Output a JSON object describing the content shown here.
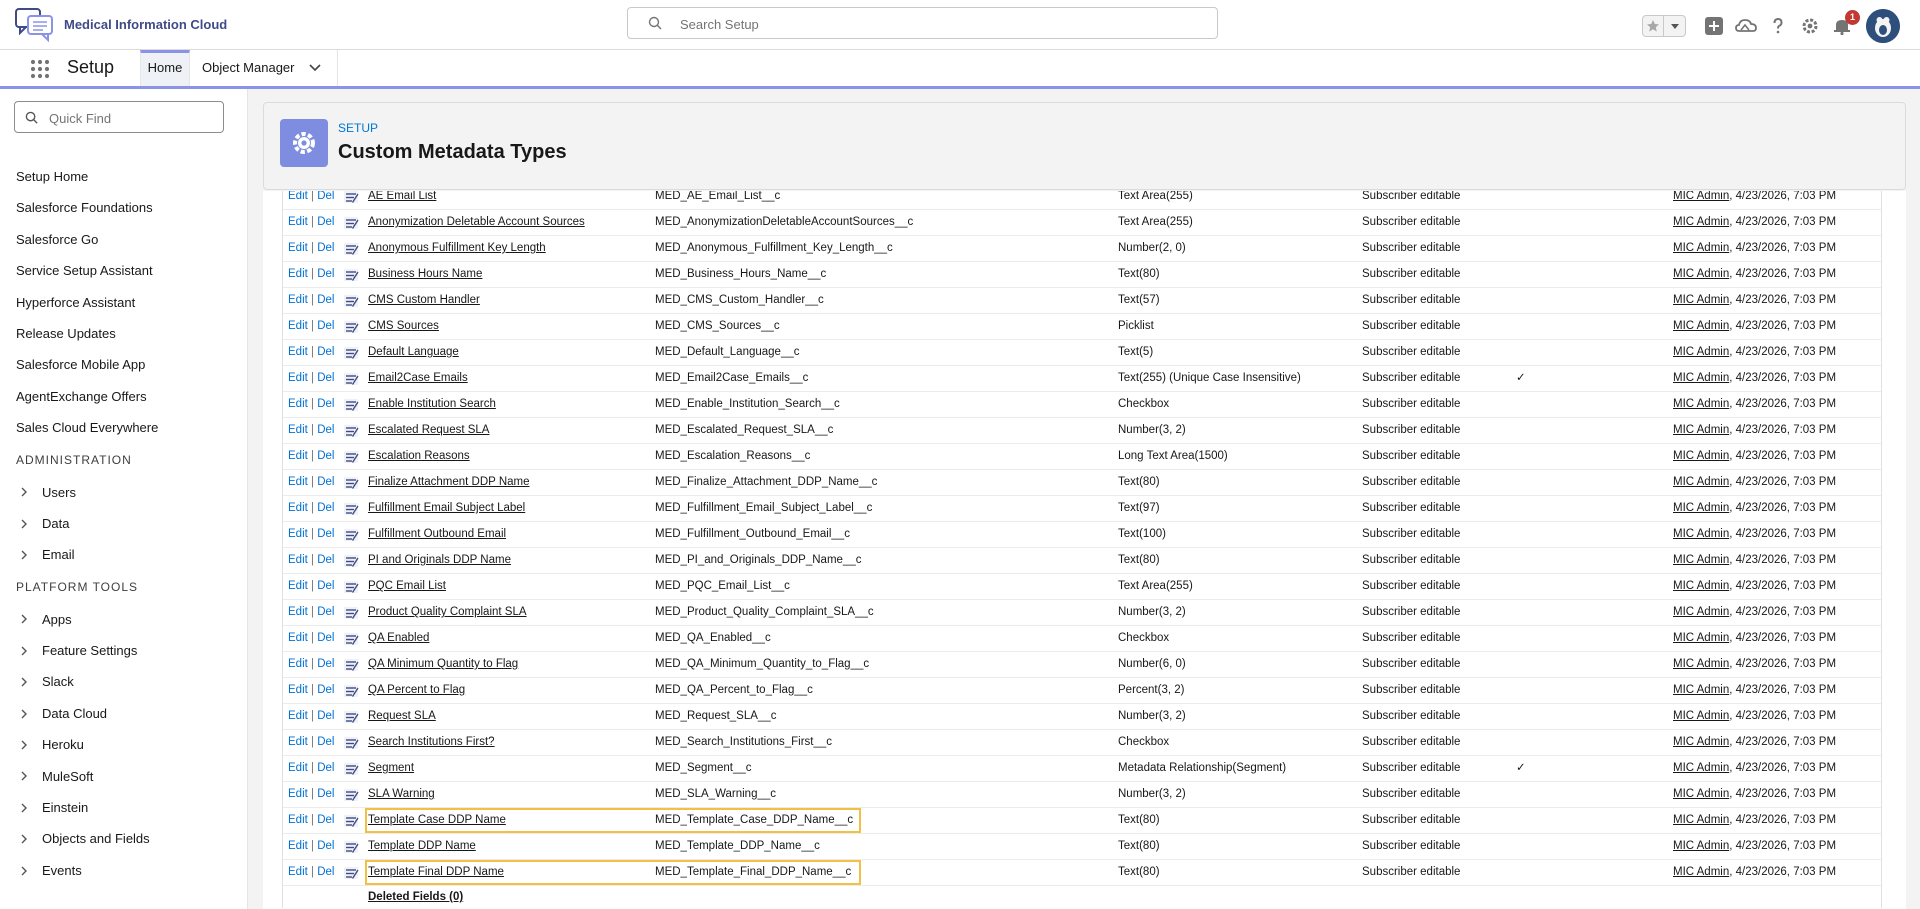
{
  "header": {
    "brand_name": "Medical Information Cloud",
    "search_placeholder": "Search Setup",
    "notification_count": "1"
  },
  "context_bar": {
    "app_name": "Setup",
    "tabs": [
      {
        "label": "Home"
      },
      {
        "label": "Object Manager"
      }
    ]
  },
  "sidebar": {
    "quick_find_placeholder": "Quick Find",
    "items": [
      "Setup Home",
      "Salesforce Foundations",
      "Salesforce Go",
      "Service Setup Assistant",
      "Hyperforce Assistant",
      "Release Updates",
      "Salesforce Mobile App",
      "AgentExchange Offers",
      "Sales Cloud Everywhere"
    ],
    "administration_heading": "ADMINISTRATION",
    "administration_items": [
      "Users",
      "Data",
      "Email"
    ],
    "platform_heading": "PLATFORM TOOLS",
    "platform_items": [
      "Apps",
      "Feature Settings",
      "Slack",
      "Data Cloud",
      "Heroku",
      "MuleSoft",
      "Einstein",
      "Objects and Fields",
      "Events"
    ]
  },
  "page_header": {
    "breadcrumb": "SETUP",
    "title": "Custom Metadata Types"
  },
  "table": {
    "edit_label": "Edit",
    "del_label": "Del",
    "separator": "|",
    "check_glyph": "✓",
    "rows": [
      {
        "label": "AE Email List",
        "api": "MED_AE_Email_List__c",
        "type": "Text Area(255)",
        "ctrl": "Subscriber editable",
        "req": "",
        "who": "MIC Admin",
        "when": ", 4/23/2026, 7:03 PM"
      },
      {
        "label": "Anonymization Deletable Account Sources",
        "api": "MED_AnonymizationDeletableAccountSources__c",
        "type": "Text Area(255)",
        "ctrl": "Subscriber editable",
        "req": "",
        "who": "MIC Admin",
        "when": ", 4/23/2026, 7:03 PM"
      },
      {
        "label": "Anonymous Fulfillment Key Length",
        "api": "MED_Anonymous_Fulfillment_Key_Length__c",
        "type": "Number(2, 0)",
        "ctrl": "Subscriber editable",
        "req": "",
        "who": "MIC Admin",
        "when": ", 4/23/2026, 7:03 PM"
      },
      {
        "label": "Business Hours Name",
        "api": "MED_Business_Hours_Name__c",
        "type": "Text(80)",
        "ctrl": "Subscriber editable",
        "req": "",
        "who": "MIC Admin",
        "when": ", 4/23/2026, 7:03 PM"
      },
      {
        "label": "CMS Custom Handler",
        "api": "MED_CMS_Custom_Handler__c",
        "type": "Text(57)",
        "ctrl": "Subscriber editable",
        "req": "",
        "who": "MIC Admin",
        "when": ", 4/23/2026, 7:03 PM"
      },
      {
        "label": "CMS Sources",
        "api": "MED_CMS_Sources__c",
        "type": "Picklist",
        "ctrl": "Subscriber editable",
        "req": "",
        "who": "MIC Admin",
        "when": ", 4/23/2026, 7:03 PM"
      },
      {
        "label": "Default Language",
        "api": "MED_Default_Language__c",
        "type": "Text(5)",
        "ctrl": "Subscriber editable",
        "req": "",
        "who": "MIC Admin",
        "when": ", 4/23/2026, 7:03 PM"
      },
      {
        "label": "Email2Case Emails",
        "api": "MED_Email2Case_Emails__c",
        "type": "Text(255) (Unique Case Insensitive)",
        "ctrl": "Subscriber editable",
        "req": "check",
        "who": "MIC Admin",
        "when": ", 4/23/2026, 7:03 PM"
      },
      {
        "label": "Enable Institution Search",
        "api": "MED_Enable_Institution_Search__c",
        "type": "Checkbox",
        "ctrl": "Subscriber editable",
        "req": "",
        "who": "MIC Admin",
        "when": ", 4/23/2026, 7:03 PM"
      },
      {
        "label": "Escalated Request SLA",
        "api": "MED_Escalated_Request_SLA__c",
        "type": "Number(3, 2)",
        "ctrl": "Subscriber editable",
        "req": "",
        "who": "MIC Admin",
        "when": ", 4/23/2026, 7:03 PM"
      },
      {
        "label": "Escalation Reasons",
        "api": "MED_Escalation_Reasons__c",
        "type": "Long Text Area(1500)",
        "ctrl": "Subscriber editable",
        "req": "",
        "who": "MIC Admin",
        "when": ", 4/23/2026, 7:03 PM"
      },
      {
        "label": "Finalize Attachment DDP Name",
        "api": "MED_Finalize_Attachment_DDP_Name__c",
        "type": "Text(80)",
        "ctrl": "Subscriber editable",
        "req": "",
        "who": "MIC Admin",
        "when": ", 4/23/2026, 7:03 PM"
      },
      {
        "label": "Fulfillment Email Subject Label",
        "api": "MED_Fulfillment_Email_Subject_Label__c",
        "type": "Text(97)",
        "ctrl": "Subscriber editable",
        "req": "",
        "who": "MIC Admin",
        "when": ", 4/23/2026, 7:03 PM"
      },
      {
        "label": "Fulfillment Outbound Email",
        "api": "MED_Fulfillment_Outbound_Email__c",
        "type": "Text(100)",
        "ctrl": "Subscriber editable",
        "req": "",
        "who": "MIC Admin",
        "when": ", 4/23/2026, 7:03 PM"
      },
      {
        "label": "PI and Originals DDP Name",
        "api": "MED_PI_and_Originals_DDP_Name__c",
        "type": "Text(80)",
        "ctrl": "Subscriber editable",
        "req": "",
        "who": "MIC Admin",
        "when": ", 4/23/2026, 7:03 PM"
      },
      {
        "label": "PQC Email List",
        "api": "MED_PQC_Email_List__c",
        "type": "Text Area(255)",
        "ctrl": "Subscriber editable",
        "req": "",
        "who": "MIC Admin",
        "when": ", 4/23/2026, 7:03 PM"
      },
      {
        "label": "Product Quality Complaint SLA",
        "api": "MED_Product_Quality_Complaint_SLA__c",
        "type": "Number(3, 2)",
        "ctrl": "Subscriber editable",
        "req": "",
        "who": "MIC Admin",
        "when": ", 4/23/2026, 7:03 PM"
      },
      {
        "label": "QA Enabled",
        "api": "MED_QA_Enabled__c",
        "type": "Checkbox",
        "ctrl": "Subscriber editable",
        "req": "",
        "who": "MIC Admin",
        "when": ", 4/23/2026, 7:03 PM"
      },
      {
        "label": "QA Minimum Quantity to Flag",
        "api": "MED_QA_Minimum_Quantity_to_Flag__c",
        "type": "Number(6, 0)",
        "ctrl": "Subscriber editable",
        "req": "",
        "who": "MIC Admin",
        "when": ", 4/23/2026, 7:03 PM"
      },
      {
        "label": "QA Percent to Flag",
        "api": "MED_QA_Percent_to_Flag__c",
        "type": "Percent(3, 2)",
        "ctrl": "Subscriber editable",
        "req": "",
        "who": "MIC Admin",
        "when": ", 4/23/2026, 7:03 PM"
      },
      {
        "label": "Request SLA",
        "api": "MED_Request_SLA__c",
        "type": "Number(3, 2)",
        "ctrl": "Subscriber editable",
        "req": "",
        "who": "MIC Admin",
        "when": ", 4/23/2026, 7:03 PM"
      },
      {
        "label": "Search Institutions First?",
        "api": "MED_Search_Institutions_First__c",
        "type": "Checkbox",
        "ctrl": "Subscriber editable",
        "req": "",
        "who": "MIC Admin",
        "when": ", 4/23/2026, 7:03 PM"
      },
      {
        "label": "Segment",
        "api": "MED_Segment__c",
        "type": "Metadata Relationship(Segment)",
        "ctrl": "Subscriber editable",
        "req": "check",
        "who": "MIC Admin",
        "when": ", 4/23/2026, 7:03 PM"
      },
      {
        "label": "SLA Warning",
        "api": "MED_SLA_Warning__c",
        "type": "Number(3, 2)",
        "ctrl": "Subscriber editable",
        "req": "",
        "who": "MIC Admin",
        "when": ", 4/23/2026, 7:03 PM"
      },
      {
        "label": "Template Case DDP Name",
        "api": "MED_Template_Case_DDP_Name__c",
        "type": "Text(80)",
        "ctrl": "Subscriber editable",
        "req": "",
        "who": "MIC Admin",
        "when": ", 4/23/2026, 7:03 PM",
        "highlight": true
      },
      {
        "label": "Template DDP Name",
        "api": "MED_Template_DDP_Name__c",
        "type": "Text(80)",
        "ctrl": "Subscriber editable",
        "req": "",
        "who": "MIC Admin",
        "when": ", 4/23/2026, 7:03 PM"
      },
      {
        "label": "Template Final DDP Name",
        "api": "MED_Template_Final_DDP_Name__c",
        "type": "Text(80)",
        "ctrl": "Subscriber editable",
        "req": "",
        "who": "MIC Admin",
        "when": ", 4/23/2026, 7:03 PM",
        "highlight": true
      }
    ],
    "deleted_fields_label": "Deleted Fields (0)"
  },
  "colors": {
    "accent": "#8b93e9",
    "link": "#0070d2",
    "highlight": "#f2c043",
    "setup_icon_bg": "#7f8de1"
  }
}
